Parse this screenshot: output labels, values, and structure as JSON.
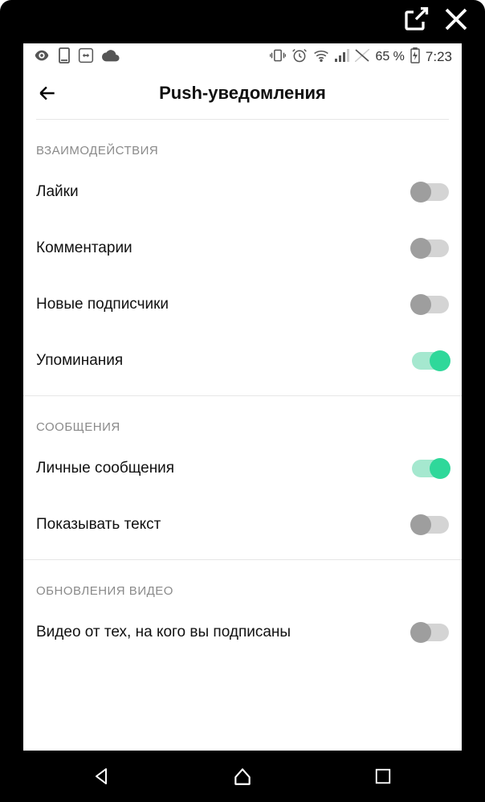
{
  "frame": {
    "open_external": "open-external",
    "close": "close"
  },
  "status": {
    "battery_pct": "65 %",
    "time": "7:23"
  },
  "header": {
    "title": "Push-уведомления"
  },
  "sections": [
    {
      "header": "ВЗАИМОДЕЙСТВИЯ",
      "items": [
        {
          "label": "Лайки",
          "on": false,
          "name": "toggle-likes"
        },
        {
          "label": "Комментарии",
          "on": false,
          "name": "toggle-comments"
        },
        {
          "label": "Новые подписчики",
          "on": false,
          "name": "toggle-new-followers"
        },
        {
          "label": "Упоминания",
          "on": true,
          "name": "toggle-mentions"
        }
      ]
    },
    {
      "header": "СООБЩЕНИЯ",
      "items": [
        {
          "label": "Личные сообщения",
          "on": true,
          "name": "toggle-direct-messages"
        },
        {
          "label": "Показывать текст",
          "on": false,
          "name": "toggle-show-text"
        }
      ]
    },
    {
      "header": "ОБНОВЛЕНИЯ ВИДЕО",
      "items": [
        {
          "label": "Видео от тех, на кого вы подписаны",
          "on": false,
          "name": "toggle-subscribed-videos"
        }
      ]
    }
  ]
}
